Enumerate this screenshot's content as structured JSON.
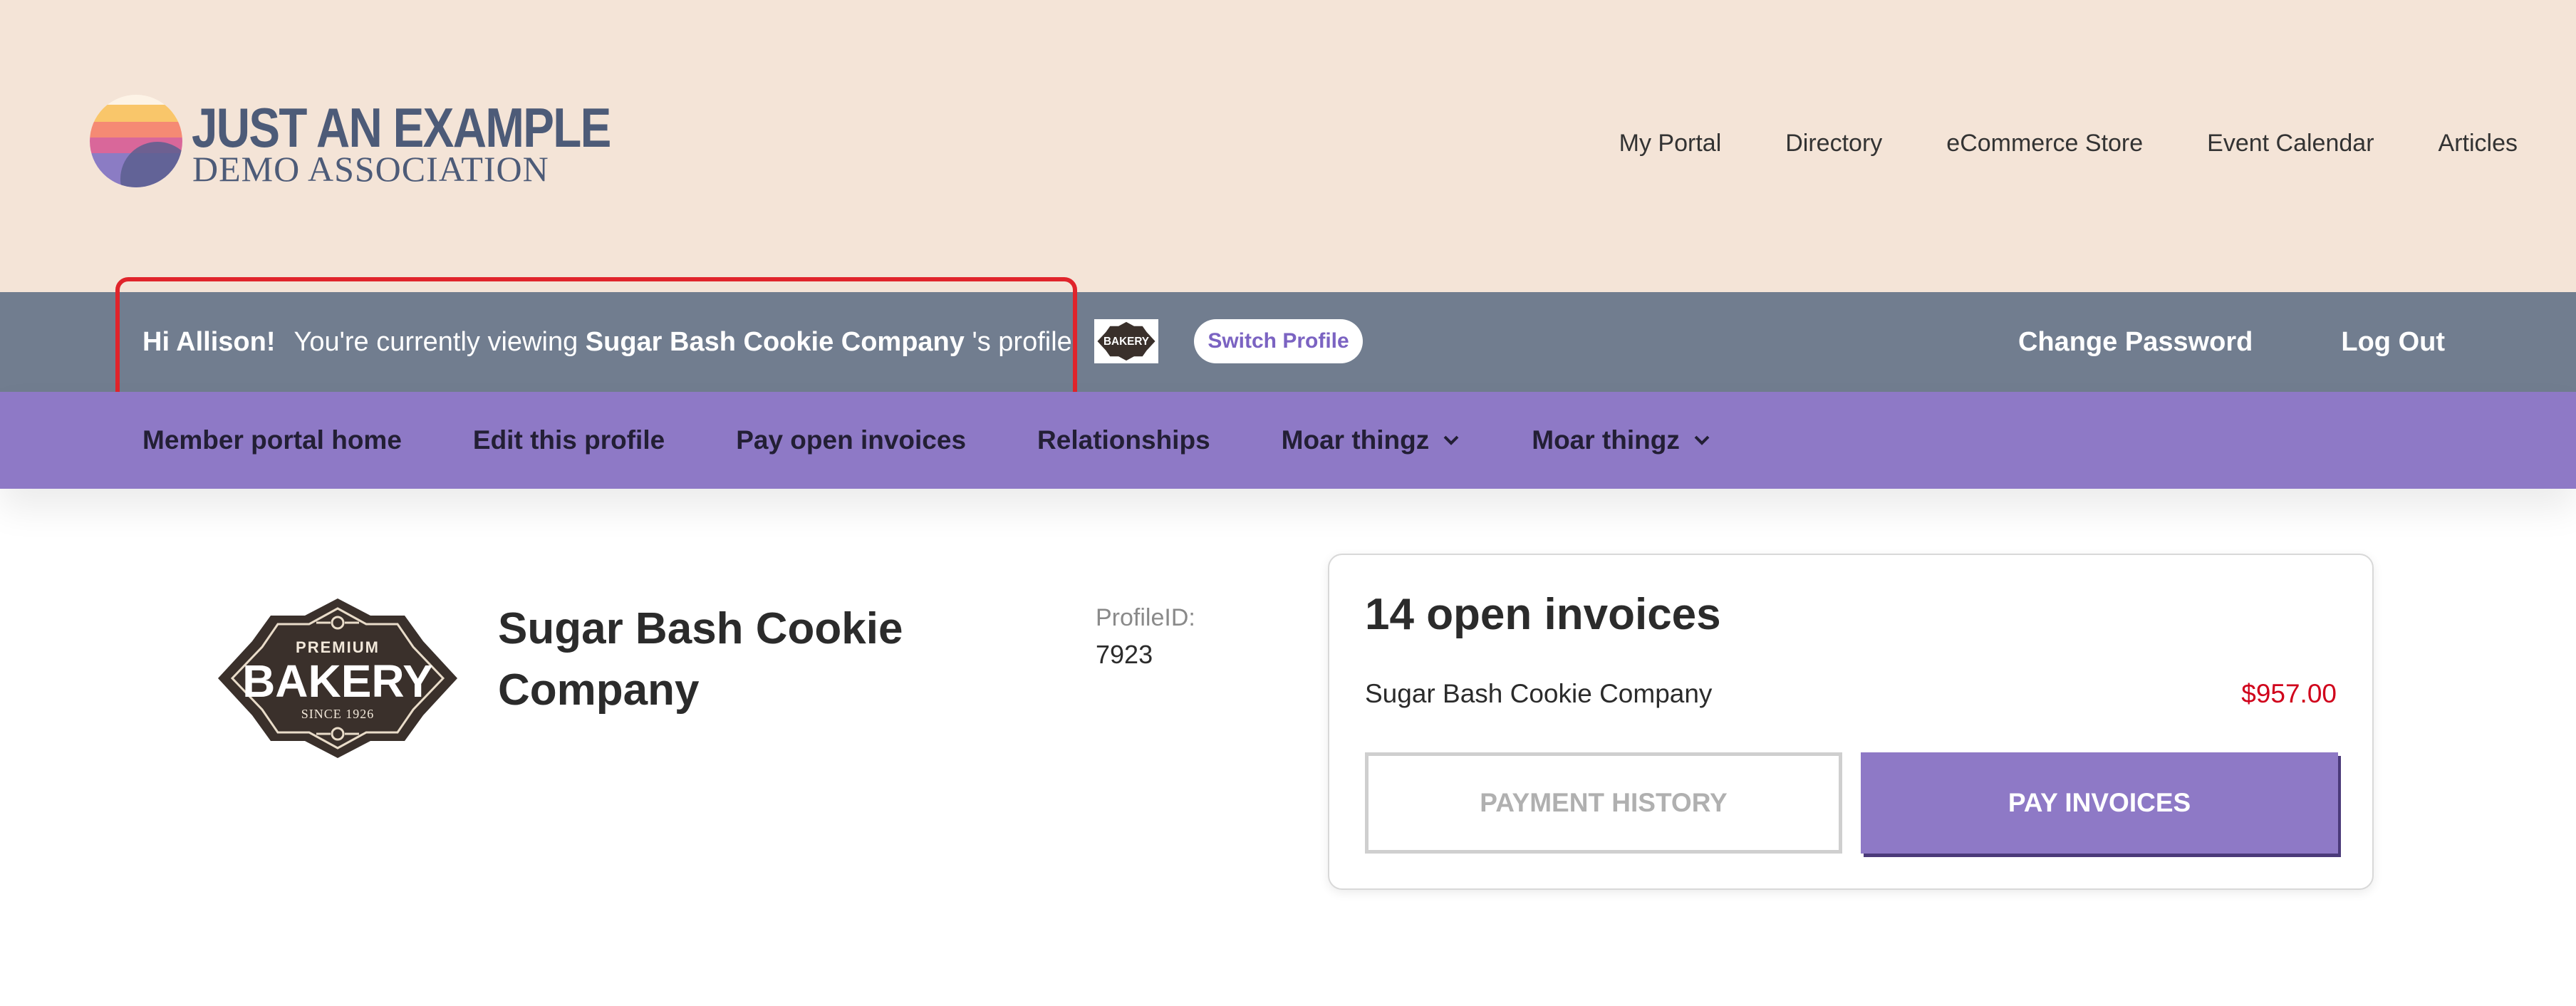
{
  "header": {
    "logo": {
      "line1": "JUST AN EXAMPLE",
      "line2": "DEMO ASSOCIATION",
      "icon": "sunset-logo-icon"
    },
    "nav": [
      {
        "label": "My Portal"
      },
      {
        "label": "Directory"
      },
      {
        "label": "eCommerce Store"
      },
      {
        "label": "Event Calendar"
      },
      {
        "label": "Articles"
      }
    ]
  },
  "user_bar": {
    "greeting": "Hi Allison!",
    "viewing_prefix": "You're currently viewing",
    "viewing_company": "Sugar Bash Cookie Company",
    "viewing_suffix": "'s profile",
    "switch_label": "Switch Profile",
    "change_password": "Change Password",
    "log_out": "Log Out",
    "highlight_color": "#e0242b"
  },
  "portal_nav": [
    {
      "label": "Member portal home"
    },
    {
      "label": "Edit this profile"
    },
    {
      "label": "Pay open invoices"
    },
    {
      "label": "Relationships"
    },
    {
      "label": "Moar thingz",
      "has_dropdown": true
    },
    {
      "label": "Moar thingz",
      "has_dropdown": true
    }
  ],
  "profile": {
    "name": "Sugar Bash Cookie Company",
    "id_label": "ProfileID:",
    "id_value": "7923",
    "logo_text": {
      "top": "PREMIUM",
      "main": "BAKERY",
      "bottom": "SINCE 1926"
    }
  },
  "invoices": {
    "title": "14 open invoices",
    "company": "Sugar Bash Cookie Company",
    "amount": "$957.00",
    "history_button": "PAYMENT HISTORY",
    "pay_button": "PAY INVOICES"
  },
  "colors": {
    "header_bg": "#f4e4d7",
    "bar_gray": "#717d8f",
    "accent_purple": "#8e79c6",
    "amount_red": "#d0021b"
  }
}
